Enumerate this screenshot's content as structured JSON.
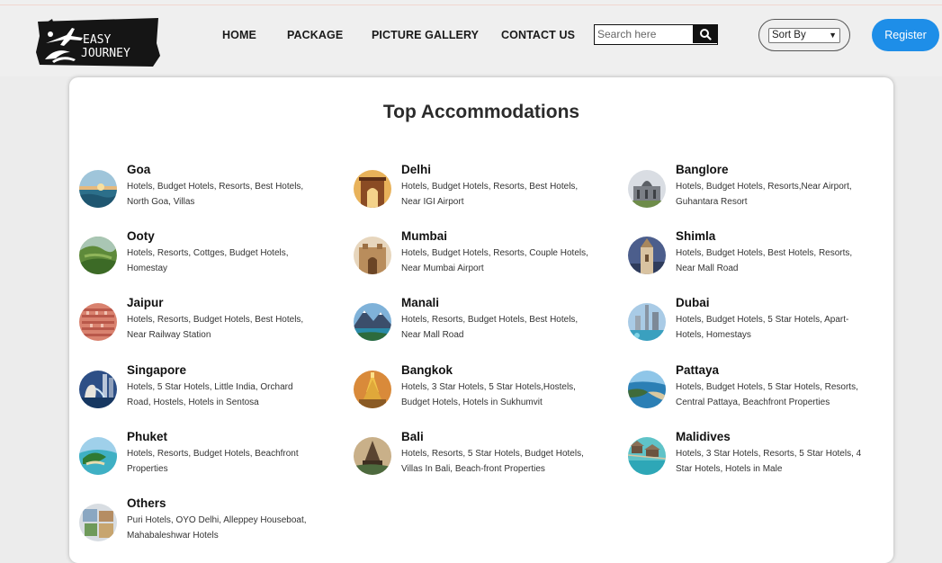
{
  "brand": {
    "line1": "EASY",
    "line2": "JOURNEY"
  },
  "nav": {
    "home": "HOME",
    "package": "PACKAGE",
    "gallery": "PICTURE GALLERY",
    "contact": "CONTACT US"
  },
  "search": {
    "placeholder": "Search here",
    "value": ""
  },
  "sort": {
    "selected": "Sort By"
  },
  "register_label": "Register",
  "colors": {
    "accent": "#1e8ee8",
    "header_bg": "#efefef",
    "page_bg": "#ececec"
  },
  "main": {
    "title": "Top Accommodations",
    "destinations": [
      {
        "name": "Goa",
        "desc": "Hotels, Budget Hotels, Resorts, Best Hotels, North Goa, Villas",
        "icon": "beach-sunset"
      },
      {
        "name": "Delhi",
        "desc": "Hotels, Budget Hotels, Resorts, Best Hotels, Near IGI Airport",
        "icon": "india-gate"
      },
      {
        "name": "Banglore",
        "desc": "Hotels, Budget Hotels, Resorts,Near Airport, Guhantara Resort",
        "icon": "palace"
      },
      {
        "name": "Ooty",
        "desc": "Hotels, Resorts, Cottges, Budget Hotels, Homestay",
        "icon": "green-hills"
      },
      {
        "name": "Mumbai",
        "desc": "Hotels, Budget Hotels, Resorts, Couple Hotels, Near Mumbai Airport",
        "icon": "gateway"
      },
      {
        "name": "Shimla",
        "desc": "Hotels, Budget Hotels, Best Hotels, Resorts, Near Mall Road",
        "icon": "church"
      },
      {
        "name": "Jaipur",
        "desc": "Hotels, Resorts, Budget Hotels, Best Hotels, Near Railway Station",
        "icon": "hawa-mahal"
      },
      {
        "name": "Manali",
        "desc": "Hotels, Resorts, Budget Hotels, Best Hotels, Near Mall Road",
        "icon": "mountain-lake"
      },
      {
        "name": "Dubai",
        "desc": "Hotels, Budget Hotels, 5 Star Hotels, Apart-Hotels, Homestays",
        "icon": "skyline"
      },
      {
        "name": "Singapore",
        "desc": "Hotels, 5 Star Hotels, Little India, Orchard Road, Hostels, Hotels in Sentosa",
        "icon": "merlion"
      },
      {
        "name": "Bangkok",
        "desc": "Hotels, 3 Star Hotels, 5 Star Hotels,Hostels, Budget Hotels, Hotels in Sukhumvit",
        "icon": "temple"
      },
      {
        "name": "Pattaya",
        "desc": "Hotels, Budget Hotels, 5 Star Hotels, Resorts, Central Pattaya, Beachfront Properties",
        "icon": "coast"
      },
      {
        "name": "Phuket",
        "desc": "Hotels, Resorts, Budget Hotels, Beachfront Properties",
        "icon": "island"
      },
      {
        "name": "Bali",
        "desc": "Hotels, Resorts, 5 Star Hotels, Budget Hotels, Villas In Bali, Beach-front Properties",
        "icon": "bali-temple"
      },
      {
        "name": "Malidives",
        "desc": "Hotels, 3 Star Hotels, Resorts, 5 Star Hotels, 4 Star Hotels, Hotels in Male",
        "icon": "water-villas"
      },
      {
        "name": "Others",
        "desc": "Puri Hotels, OYO Delhi, Alleppey Houseboat, Mahabaleshwar Hotels",
        "icon": "collage"
      }
    ]
  }
}
